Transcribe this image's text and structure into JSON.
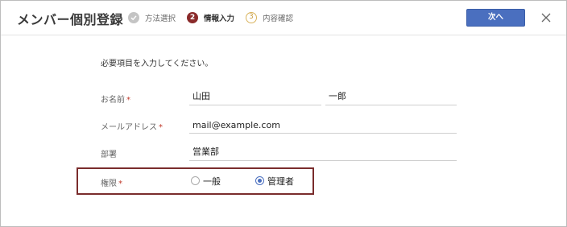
{
  "header": {
    "title": "メンバー個別登録",
    "steps": [
      {
        "number": "1",
        "label": "方法選択",
        "state": "done"
      },
      {
        "number": "2",
        "label": "情報入力",
        "state": "current"
      },
      {
        "number": "3",
        "label": "内容確認",
        "state": "upcoming"
      }
    ],
    "next_label": "次へ"
  },
  "form": {
    "intro": "必要項目を入力してください。",
    "required_mark": "*",
    "name": {
      "label": "お名前",
      "last_name": "山田",
      "first_name": "一郎"
    },
    "email": {
      "label": "メールアドレス",
      "value": "mail@example.com"
    },
    "department": {
      "label": "部署",
      "value": "営業部"
    },
    "role": {
      "label": "権限",
      "options": [
        {
          "label": "一般",
          "selected": false
        },
        {
          "label": "管理者",
          "selected": true
        }
      ]
    }
  },
  "colors": {
    "accent": "#4a6fbf",
    "current_step": "#8a2a2a",
    "highlight_border": "#7a2c2c",
    "required": "#c0392b"
  }
}
